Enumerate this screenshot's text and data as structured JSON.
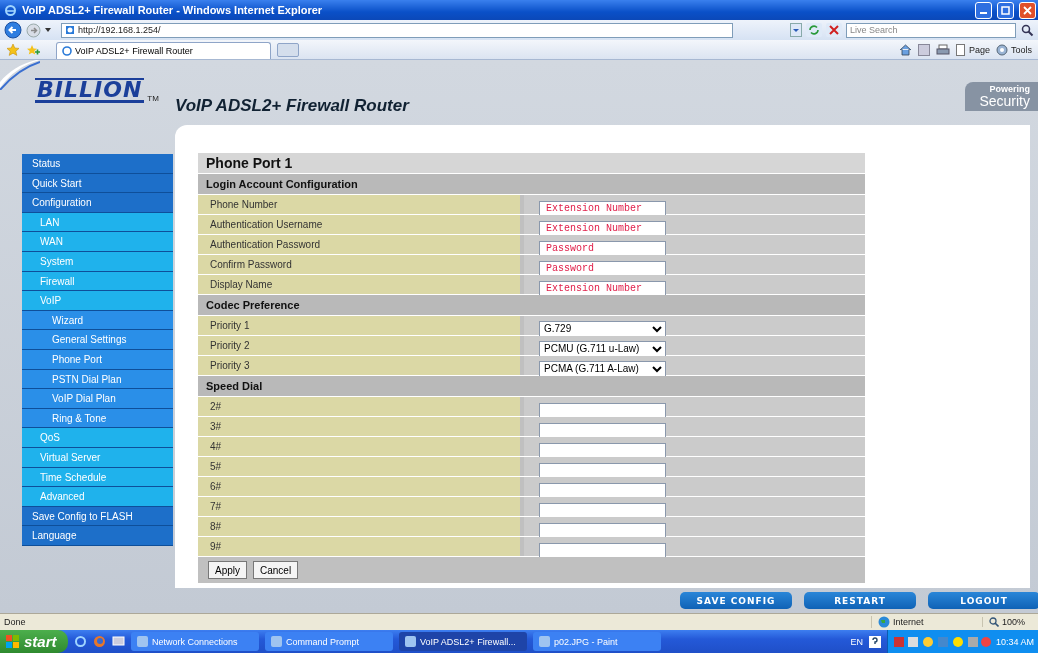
{
  "window": {
    "title": "VoIP ADSL2+ Firewall Router - Windows Internet Explorer"
  },
  "address_bar": {
    "url": "http://192.168.1.254/"
  },
  "search": {
    "placeholder": "Live Search"
  },
  "tabs": [
    {
      "label": "VoIP ADSL2+ Firewall Router",
      "selected": true
    }
  ],
  "command_bar": [
    "Page",
    "Tools"
  ],
  "header": {
    "logo": "BILLION",
    "trademark": "TM",
    "title": "VoIP ADSL2+ Firewall Router",
    "tagline": [
      "Powering",
      "Security"
    ]
  },
  "sidebar": {
    "items": [
      {
        "label": "Status"
      },
      {
        "label": "Quick Start"
      },
      {
        "label": "Configuration",
        "children": [
          {
            "label": "LAN"
          },
          {
            "label": "WAN"
          },
          {
            "label": "System"
          },
          {
            "label": "Firewall"
          },
          {
            "label": "VoIP",
            "children": [
              {
                "label": "Wizard"
              },
              {
                "label": "General Settings"
              },
              {
                "label": "Phone Port"
              },
              {
                "label": "PSTN Dial Plan"
              },
              {
                "label": "VoIP Dial Plan"
              },
              {
                "label": "Ring & Tone"
              }
            ]
          },
          {
            "label": "QoS"
          },
          {
            "label": "Virtual Server"
          },
          {
            "label": "Time Schedule"
          },
          {
            "label": "Advanced"
          }
        ]
      },
      {
        "label": "Save Config to FLASH"
      },
      {
        "label": "Language"
      }
    ]
  },
  "form": {
    "title": "Phone Port 1",
    "sections": [
      {
        "heading": "Login Account Configuration",
        "rows": [
          {
            "label": "Phone Number",
            "kind": "text",
            "value": "Extension Number"
          },
          {
            "label": "Authentication Username",
            "kind": "text",
            "value": "Extension Number"
          },
          {
            "label": "Authentication Password",
            "kind": "text",
            "value": "Password"
          },
          {
            "label": "Confirm Password",
            "kind": "text",
            "value": "Password"
          },
          {
            "label": "Display Name",
            "kind": "text",
            "value": "Extension Number"
          }
        ]
      },
      {
        "heading": "Codec Preference",
        "rows": [
          {
            "label": "Priority 1",
            "kind": "select",
            "value": "G.729"
          },
          {
            "label": "Priority 2",
            "kind": "select",
            "value": "PCMU (G.711 u-Law)"
          },
          {
            "label": "Priority 3",
            "kind": "select",
            "value": "PCMA (G.711 A-Law)"
          }
        ]
      },
      {
        "heading": "Speed Dial",
        "rows": [
          {
            "label": "2#",
            "kind": "text"
          },
          {
            "label": "3#",
            "kind": "text"
          },
          {
            "label": "4#",
            "kind": "text"
          },
          {
            "label": "5#",
            "kind": "text"
          },
          {
            "label": "6#",
            "kind": "text"
          },
          {
            "label": "7#",
            "kind": "text"
          },
          {
            "label": "8#",
            "kind": "text"
          },
          {
            "label": "9#",
            "kind": "text"
          }
        ]
      }
    ],
    "buttons": [
      "Apply",
      "Cancel"
    ]
  },
  "actions": [
    "SAVE CONFIG",
    "RESTART",
    "LOGOUT"
  ],
  "status_bar": {
    "text": "Done",
    "zone": "Internet",
    "zoom": "100%"
  },
  "taskbar": {
    "start": "start",
    "tasks": [
      {
        "label": "Network Connections",
        "selected": false
      },
      {
        "label": "Command Prompt",
        "selected": false
      },
      {
        "label": "VoIP ADSL2+ Firewall...",
        "selected": true
      },
      {
        "label": "p02.JPG - Paint",
        "selected": false
      }
    ],
    "language": "EN",
    "clock": "10:34 AM"
  }
}
